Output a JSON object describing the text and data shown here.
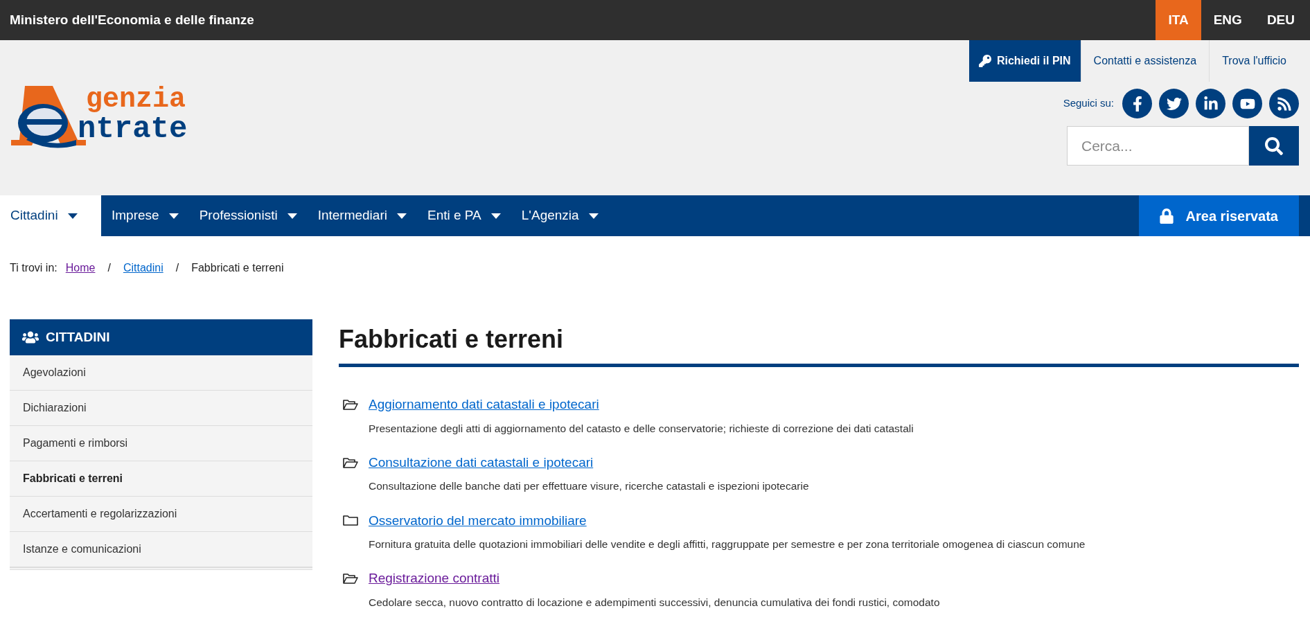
{
  "top_bar": {
    "title": "Ministero dell'Economia e delle finanze",
    "languages": [
      {
        "label": "ITA",
        "selected": true
      },
      {
        "label": "ENG",
        "selected": false
      },
      {
        "label": "DEU",
        "selected": false
      }
    ]
  },
  "header": {
    "logo": {
      "line_1": "genzia",
      "line_2": "ntrate"
    },
    "utility_links": [
      {
        "label": "Richiedi il PIN",
        "kind": "primary"
      },
      {
        "label": "Contatti e assistenza",
        "kind": "plain"
      },
      {
        "label": "Trova l'ufficio",
        "kind": "plain"
      }
    ],
    "social_label": "Seguici su:",
    "search": {
      "placeholder": "Cerca..."
    }
  },
  "nav": {
    "items": [
      {
        "label": "Cittadini",
        "selected": true
      },
      {
        "label": "Imprese",
        "selected": false
      },
      {
        "label": "Professionisti",
        "selected": false
      },
      {
        "label": "Intermediari",
        "selected": false
      },
      {
        "label": "Enti e PA",
        "selected": false
      },
      {
        "label": "L'Agenzia",
        "selected": false
      }
    ],
    "reserved_area": "Area riservata"
  },
  "breadcrumb": {
    "label": "Ti trovi in:",
    "separator": "/",
    "items": [
      {
        "label": "Home",
        "kind": "link",
        "visited": true
      },
      {
        "label": "Cittadini",
        "kind": "link",
        "visited": false
      },
      {
        "label": "Fabbricati e terreni",
        "kind": "current"
      }
    ]
  },
  "sidebar": {
    "title": "CITTADINI",
    "items": [
      {
        "label": "Agevolazioni",
        "selected": false
      },
      {
        "label": "Dichiarazioni",
        "selected": false
      },
      {
        "label": "Pagamenti e rimborsi",
        "selected": false
      },
      {
        "label": "Fabbricati e terreni",
        "selected": true
      },
      {
        "label": "Accertamenti e regolarizzazioni",
        "selected": false
      },
      {
        "label": "Istanze e comunicazioni",
        "selected": false
      }
    ]
  },
  "content": {
    "title": "Fabbricati e terreni",
    "items": [
      {
        "kind": "folder-open",
        "visited": false,
        "title": "Aggiornamento dati catastali e ipotecari",
        "description": "Presentazione degli atti di aggiornamento del catasto e delle conservatorie; richieste di correzione dei dati catastali"
      },
      {
        "kind": "folder-open",
        "visited": false,
        "title": "Consultazione dati catastali e ipotecari",
        "description": "Consultazione delle banche dati per effettuare visure, ricerche catastali e ispezioni ipotecarie"
      },
      {
        "kind": "folder",
        "visited": false,
        "title": "Osservatorio del mercato immobiliare",
        "description": "Fornitura gratuita delle quotazioni immobiliari delle vendite e degli affitti, raggruppate per semestre e per zona territoriale omogenea di ciascun comune"
      },
      {
        "kind": "folder-open",
        "visited": true,
        "title": "Registrazione contratti",
        "description": "Cedolare secca, nuovo contratto di locazione e adempimenti successivi, denuncia cumulativa dei fondi rustici, comodato"
      }
    ]
  }
}
